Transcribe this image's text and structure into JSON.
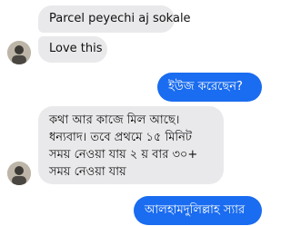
{
  "messages": [
    {
      "side": "incoming",
      "text": "Parcel peyechi aj sokale"
    },
    {
      "side": "incoming",
      "text": "Love this"
    },
    {
      "side": "outgoing",
      "text": "ইউজ করেছেন?"
    },
    {
      "side": "incoming",
      "text": "কথা আর কাজে মিল আছে। ধন্যবাদ। তবে প্রথমে ১৫ মিনিট সময় নেওয়া যায় ২ য় বার ৩০+ সময় নেওয়া যায়"
    },
    {
      "side": "outgoing",
      "text": "আলহামদুলিল্লাহ স্যার"
    }
  ],
  "avatars": [
    {
      "icon": "contact-avatar-icon"
    },
    {
      "icon": "contact-avatar-icon"
    }
  ],
  "colors": {
    "incoming_bubble": "#e9e9eb",
    "outgoing_bubble": "#1a6cf0",
    "outgoing_text": "#ffffff"
  }
}
